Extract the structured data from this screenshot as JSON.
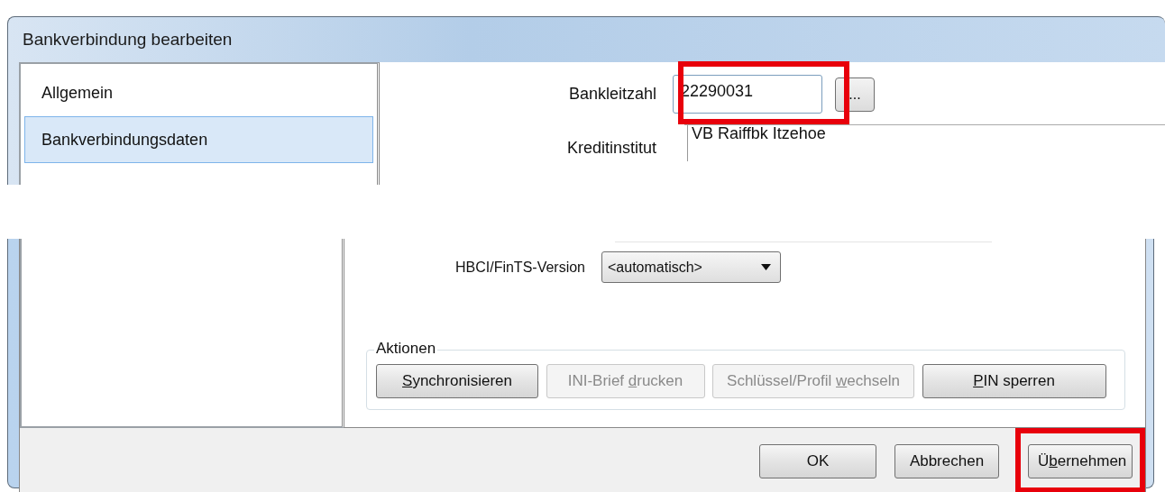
{
  "window": {
    "title": "Bankverbindung bearbeiten"
  },
  "sidebar": {
    "items": [
      {
        "label": "Allgemein",
        "selected": false
      },
      {
        "label": "Bankverbindungsdaten",
        "selected": true
      }
    ]
  },
  "bank_code": {
    "label": "Bankleitzahl",
    "value": "22290031",
    "highlighted": true,
    "lookup_button": "..."
  },
  "institution": {
    "label": "Kreditinstitut",
    "value": "VB Raiffbk Itzehoe"
  },
  "hbci_version": {
    "label": "HBCI/FinTS-Version",
    "value": "<automatisch>"
  },
  "actions": {
    "title": "Aktionen",
    "buttons": [
      {
        "label_parts": [
          {
            "text": "S",
            "underlined": true
          },
          {
            "text": "ynchronisieren",
            "underlined": false
          }
        ],
        "disabled": false
      },
      {
        "label_parts": [
          {
            "text": "INI-Brief ",
            "underlined": false
          },
          {
            "text": "d",
            "underlined": true
          },
          {
            "text": "rucken",
            "underlined": false
          }
        ],
        "disabled": true
      },
      {
        "label_parts": [
          {
            "text": "Schlüssel/Profil ",
            "underlined": false
          },
          {
            "text": "w",
            "underlined": true
          },
          {
            "text": "echseln",
            "underlined": false
          }
        ],
        "disabled": true
      },
      {
        "label_parts": [
          {
            "text": "P",
            "underlined": true
          },
          {
            "text": "IN sperren",
            "underlined": false
          }
        ],
        "disabled": false
      }
    ]
  },
  "footer_buttons": [
    {
      "label_parts": [
        {
          "text": "OK",
          "underlined": false
        }
      ],
      "highlighted": false
    },
    {
      "label_parts": [
        {
          "text": "Abbrechen",
          "underlined": false
        }
      ],
      "highlighted": false
    },
    {
      "label_parts": [
        {
          "text": "Ü",
          "underlined": false
        },
        {
          "text": "b",
          "underlined": true
        },
        {
          "text": "ernehmen",
          "underlined": false
        }
      ],
      "highlighted": true
    }
  ]
}
